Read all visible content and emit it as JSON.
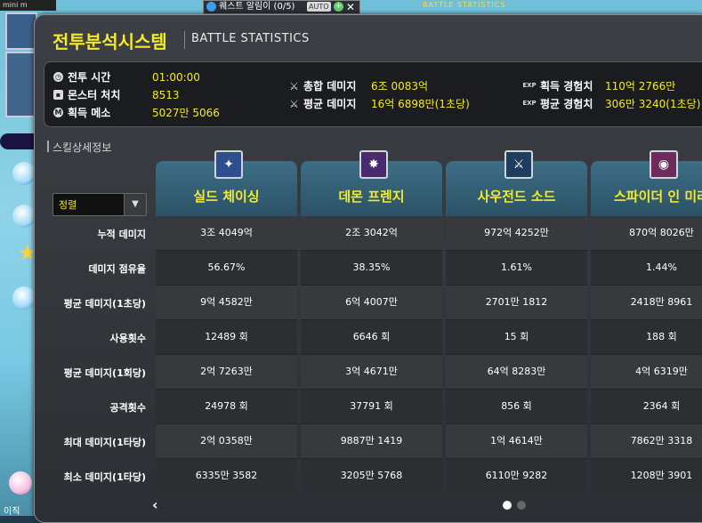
{
  "background": {
    "minimap_label": "mini m",
    "bottom_text": "이직"
  },
  "quest_tab": {
    "title": "퀘스트 알림이 (0/5)",
    "auto_label": "AUTO",
    "plus": "+",
    "close": "✕"
  },
  "top_caption": "BATTLE STATISTICS",
  "window": {
    "title": "전투분석시스템",
    "subtitle": "BATTLE STATISTICS"
  },
  "stats": {
    "battle_time": {
      "label": "전투 시간",
      "value": "01:00:00",
      "icon": "clock-icon"
    },
    "monster_kills": {
      "label": "몬스터 처치",
      "value": "8513",
      "icon": "monster-icon"
    },
    "meso": {
      "label": "획득 메소",
      "value": "5027만 5066",
      "icon": "meso-icon"
    },
    "total_damage": {
      "label": "총합 데미지",
      "value": "6조 0083억",
      "icon": "sword-icon"
    },
    "avg_damage": {
      "label": "평균 데미지",
      "value": "16억 6898만(1초당)",
      "icon": "sword-icon"
    },
    "exp_gain": {
      "label": "획득 경험치",
      "value": "110억 2766만",
      "icon": "exp-icon"
    },
    "exp_avg": {
      "label": "평균 경험치",
      "value": "306만 3240(1초당)",
      "icon": "exp-icon"
    },
    "exp_tag": "EXP"
  },
  "skill_section": {
    "label": "스킬상세정보",
    "sort_label": "정렬",
    "sort_button": "▼",
    "rows": [
      "누적 데미지",
      "데미지 점유율",
      "평균 데미지(1초당)",
      "사용횟수",
      "평균 데미지(1회당)",
      "공격횟수",
      "최대 데미지(1타당)",
      "최소 데미지(1타당)"
    ]
  },
  "skills": [
    {
      "name": "실드 체이싱",
      "icon": "shield-chasing-icon",
      "glyph": "✦",
      "color": "#2d4f8e",
      "values": [
        "3조 4049억",
        "56.67%",
        "9억 4582만",
        "12489 회",
        "2억 7263만",
        "24978 회",
        "2억 0358만",
        "6335만 3582"
      ]
    },
    {
      "name": "데몬 프렌지",
      "icon": "demon-frenzy-icon",
      "glyph": "✸",
      "color": "#4a2a6e",
      "values": [
        "2조 3042억",
        "38.35%",
        "6억 4007만",
        "6646 회",
        "3억 4671만",
        "37791 회",
        "9887만 1419",
        "3205만 5768"
      ]
    },
    {
      "name": "사우전드 소드",
      "icon": "thousand-sword-icon",
      "glyph": "⚔",
      "color": "#1f3d5e",
      "values": [
        "972억 4252만",
        "1.61%",
        "2701만 1812",
        "15 회",
        "64억 8283만",
        "856 회",
        "1억 4614만",
        "6110만 9282"
      ]
    },
    {
      "name": "스파이더 인 미러",
      "icon": "spider-in-mirror-icon",
      "glyph": "◉",
      "color": "#6e2a5a",
      "values": [
        "870억 8026만",
        "1.44%",
        "2418만 8961",
        "188 회",
        "4억 6319만",
        "2364 회",
        "7862만 3318",
        "1208만 3901"
      ]
    }
  ],
  "pagination": {
    "prev": "‹",
    "active_color": "#ffffff",
    "inactive_color": "#666666"
  }
}
